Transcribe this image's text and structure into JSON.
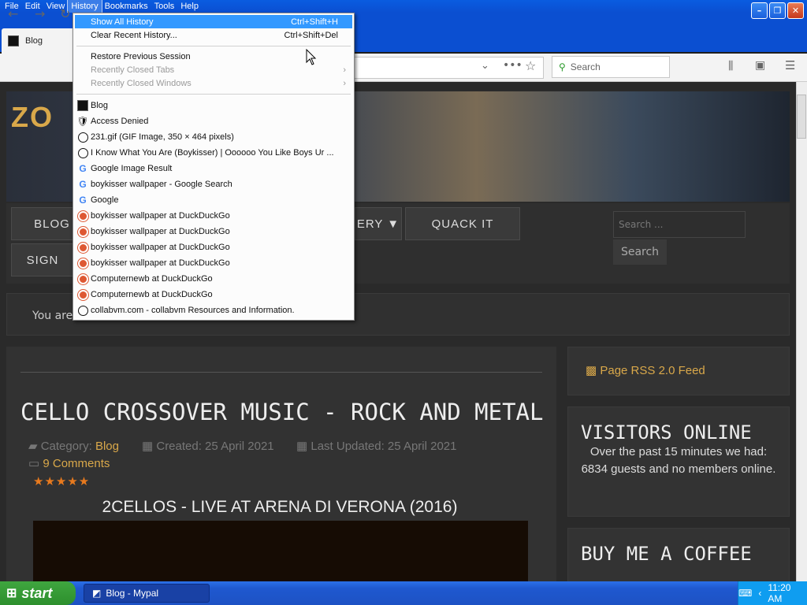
{
  "menubar": {
    "items": [
      "File",
      "Edit",
      "View",
      "History",
      "Bookmarks",
      "Tools",
      "Help"
    ]
  },
  "tab": {
    "title": "Blog"
  },
  "toolbar": {
    "search_placeholder": "Search"
  },
  "history_menu": {
    "show_all": {
      "label": "Show All History",
      "shortcut": "Ctrl+Shift+H"
    },
    "clear_recent": {
      "label": "Clear Recent History...",
      "shortcut": "Ctrl+Shift+Del"
    },
    "restore_session": "Restore Previous Session",
    "recent_tabs": "Recently Closed Tabs",
    "recent_windows": "Recently Closed Windows",
    "entries": [
      {
        "icon": "blog-favicon",
        "label": "Blog"
      },
      {
        "icon": "lock-icon",
        "label": "Access Denied"
      },
      {
        "icon": "globe-icon",
        "label": "231.gif (GIF Image, 350 × 464 pixels)"
      },
      {
        "icon": "globe-icon",
        "label": "I Know What You Are (Boykisser) | Oooooo You Like Boys Ur ..."
      },
      {
        "icon": "google-icon",
        "label": "Google Image Result"
      },
      {
        "icon": "google-icon",
        "label": "boykisser wallpaper - Google Search"
      },
      {
        "icon": "google-icon",
        "label": "Google"
      },
      {
        "icon": "duckduckgo-icon",
        "label": "boykisser wallpaper at DuckDuckGo"
      },
      {
        "icon": "duckduckgo-icon",
        "label": "boykisser wallpaper at DuckDuckGo"
      },
      {
        "icon": "duckduckgo-icon",
        "label": "boykisser wallpaper at DuckDuckGo"
      },
      {
        "icon": "duckduckgo-icon",
        "label": "boykisser wallpaper at DuckDuckGo"
      },
      {
        "icon": "duckduckgo-icon",
        "label": "Computernewb at DuckDuckGo"
      },
      {
        "icon": "duckduckgo-icon",
        "label": "Computernewb at DuckDuckGo"
      },
      {
        "icon": "globe-icon",
        "label": "collabvm.com - collabvm Resources and Information."
      }
    ]
  },
  "site": {
    "logo": "ZO",
    "nav": [
      "BLOG",
      "SIGN",
      "ERY ▼",
      "QUACK IT"
    ],
    "search_placeholder": "Search ...",
    "search_button": "Search",
    "breadcrumb": "You are"
  },
  "article": {
    "title": "CELLO CROSSOVER MUSIC - ROCK AND METAL",
    "category_label": "Category:",
    "category": "Blog",
    "created": "Created: 25 April 2021",
    "updated": "Last Updated: 25 April 2021",
    "comments": "9 Comments",
    "rating": 5,
    "stars": "★★★★★",
    "subtitle": "2CELLOS - LIVE AT ARENA DI VERONA (2016)"
  },
  "sidebar": {
    "rss": "Page RSS 2.0 Feed",
    "visitors_title": "VISITORS ONLINE",
    "visitors_text": "Over the past 15 minutes we had: 6834 guests and no members online.",
    "coffee_title": "BUY ME A COFFEE"
  },
  "taskbar": {
    "start": "start",
    "task": "Blog - Mypal",
    "clock": "11:20 AM"
  }
}
